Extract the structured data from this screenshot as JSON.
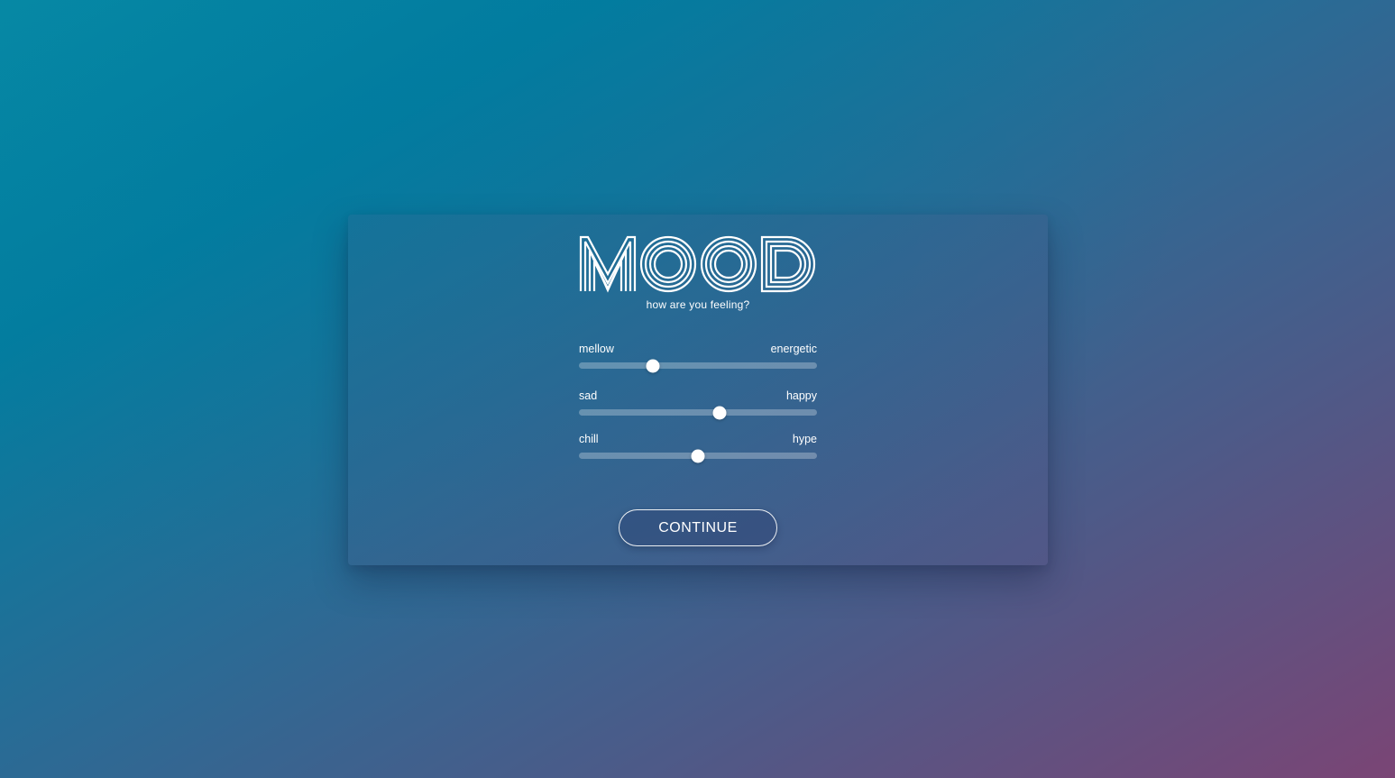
{
  "app": {
    "logo_text": "MOOD",
    "subtitle": "how are you feeling?"
  },
  "sliders": [
    {
      "left_label": "mellow",
      "right_label": "energetic",
      "value": 0.31
    },
    {
      "left_label": "sad",
      "right_label": "happy",
      "value": 0.59
    },
    {
      "left_label": "chill",
      "right_label": "hype",
      "value": 0.5
    }
  ],
  "actions": {
    "continue_label": "CONTINUE"
  },
  "colors": {
    "gradient_start": "#078aa5",
    "gradient_end": "#7a4575",
    "text": "#ffffff"
  }
}
